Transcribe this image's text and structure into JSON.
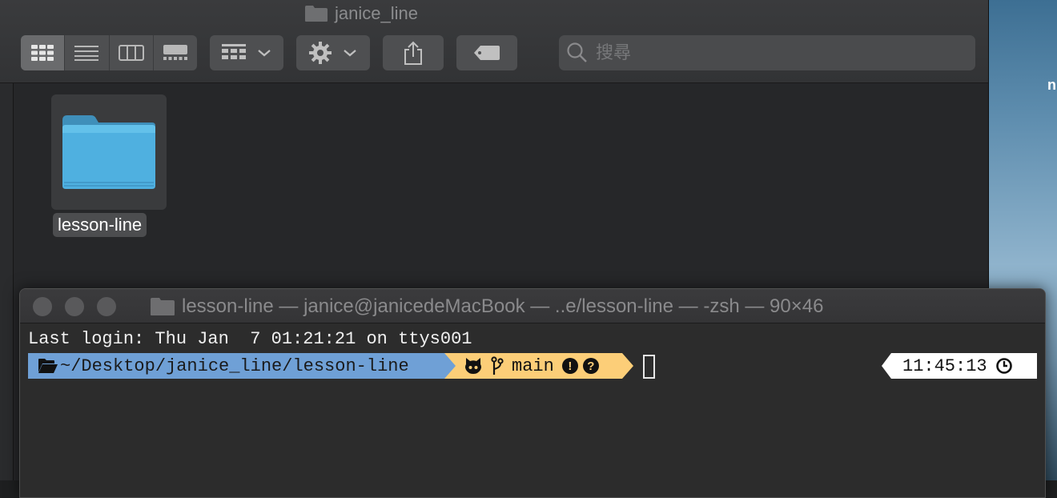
{
  "finder": {
    "title": "janice_line",
    "toolbar": {
      "view_modes": [
        "icon-view",
        "list-view",
        "column-view",
        "gallery-view"
      ],
      "active_view": "icon-view",
      "search_placeholder": "搜尋"
    },
    "items": [
      {
        "name": "lesson-line",
        "icon": "folder-icon",
        "selected": true
      }
    ]
  },
  "terminal": {
    "title": "lesson-line — janice@janicedeMacBook — ..e/lesson-line — -zsh — 90×46",
    "last_login": "Last login: Thu Jan  7 01:21:21 on ttys001",
    "prompt": {
      "path": "~/Desktop/janice_line/lesson-line",
      "branch": "main",
      "status_icons": [
        "!",
        "?"
      ],
      "time": "11:45:13"
    }
  },
  "desktop": {
    "partial_text": "n"
  },
  "colors": {
    "path_segment": "#6fa0d6",
    "git_segment": "#fcce78",
    "time_segment": "#ffffff",
    "folder_blue": "#4fb0e0"
  }
}
